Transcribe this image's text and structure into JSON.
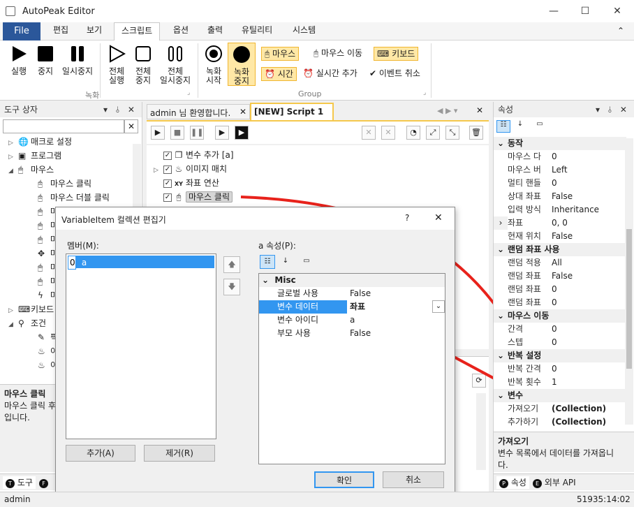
{
  "window": {
    "title": "AutoPeak Editor",
    "min": "—",
    "max": "☐",
    "close": "✕"
  },
  "menu": {
    "file": "File",
    "tabs": [
      "편집",
      "보기",
      "스크립트",
      "옵션",
      "출력",
      "유틸리티",
      "시스템"
    ],
    "collapse": "⌃"
  },
  "ribbon": {
    "record": {
      "run": "실행",
      "stop": "중지",
      "pause": "일시중지",
      "all_run": [
        "전체",
        "실행"
      ],
      "all_stop": [
        "전체",
        "중지"
      ],
      "all_pause": [
        "전체",
        "일시중지"
      ],
      "label": "녹화"
    },
    "group": {
      "rec_start": [
        "녹화",
        "시작"
      ],
      "rec_stop": [
        "녹화",
        "중지"
      ],
      "mouse": "마우스",
      "mouse_move": "마우스 이동",
      "keyboard": "키보드",
      "time": "시간",
      "realtime_add": "실시간 추가",
      "event_cancel": "이벤트 취소",
      "label": "Group"
    }
  },
  "toolbox": {
    "title": "도구 상자",
    "pin": "▾ ⫰ ✕",
    "clear": "✕",
    "items": [
      {
        "label": "매크로 설정",
        "icon": "globe-icon",
        "indent": 1,
        "exp": "▷"
      },
      {
        "label": "프로그램",
        "icon": "program-icon",
        "indent": 1,
        "exp": "▷"
      },
      {
        "label": "마우스",
        "icon": "mouse-icon",
        "indent": 1,
        "exp": "◢"
      },
      {
        "label": "마우스 클릭",
        "icon": "mouse-click-icon",
        "indent": 2,
        "exp": ""
      },
      {
        "label": "마우스 더블 클릭",
        "icon": "mouse-dblclick-icon",
        "indent": 2,
        "exp": ""
      },
      {
        "label": "마",
        "icon": "mouse-icon",
        "indent": 2,
        "exp": ""
      },
      {
        "label": "마",
        "icon": "mouse-icon",
        "indent": 2,
        "exp": ""
      },
      {
        "label": "마",
        "icon": "mouse-icon",
        "indent": 2,
        "exp": ""
      },
      {
        "label": "마",
        "icon": "move-icon",
        "indent": 2,
        "exp": ""
      },
      {
        "label": "마",
        "icon": "mouse-icon",
        "indent": 2,
        "exp": ""
      },
      {
        "label": "마",
        "icon": "mouse-icon",
        "indent": 2,
        "exp": ""
      },
      {
        "label": "마",
        "icon": "bolt-icon",
        "indent": 2,
        "exp": ""
      },
      {
        "label": "키보드",
        "icon": "keyboard-icon",
        "indent": 1,
        "exp": "▷"
      },
      {
        "label": "조건",
        "icon": "condition-icon",
        "indent": 1,
        "exp": "◢"
      },
      {
        "label": "픽",
        "icon": "eyedropper-icon",
        "indent": 2,
        "exp": ""
      },
      {
        "label": "이",
        "icon": "image-icon",
        "indent": 2,
        "exp": ""
      },
      {
        "label": "이",
        "icon": "image-icon",
        "indent": 2,
        "exp": ""
      }
    ],
    "desc_title": "마우스 클릭",
    "desc_text": [
      "마우스 클릭 후",
      "입니다."
    ],
    "bottom_tabs": [
      "도구",
      "F"
    ]
  },
  "editor": {
    "tabs": [
      {
        "label": "admin 님 환영합니다."
      },
      {
        "label": "[NEW] Script 1"
      }
    ],
    "rows": [
      {
        "text": "변수 추가 [a]",
        "icon": "variable-add-icon",
        "exp": ""
      },
      {
        "text": "이미지 매치",
        "icon": "image-match-icon",
        "exp": "▷"
      },
      {
        "text": "좌표 연산",
        "icon": "xy-icon",
        "exp": ""
      },
      {
        "text": "마우스 클릭",
        "icon": "mouse-click-icon",
        "exp": ""
      }
    ]
  },
  "properties": {
    "title": "속성",
    "pin": "▾ ⫰ ✕",
    "rows": [
      {
        "cat": "동작"
      },
      {
        "k": "마우스 다",
        "v": "0"
      },
      {
        "k": "마우스 버",
        "v": "Left"
      },
      {
        "k": "멀티 핸들",
        "v": "0"
      },
      {
        "k": "상대 좌표",
        "v": "False"
      },
      {
        "k": "입력 방식",
        "v": "Inheritance"
      },
      {
        "k": "좌표",
        "v": "0, 0",
        "exp": "›"
      },
      {
        "k": "현재 위치",
        "v": "False"
      },
      {
        "cat": "랜덤 좌표 사용"
      },
      {
        "k": "랜덤 적용",
        "v": "All"
      },
      {
        "k": "랜덤 좌표",
        "v": "False"
      },
      {
        "k": "랜덤 좌표",
        "v": "0"
      },
      {
        "k": "랜덤 좌표",
        "v": "0"
      },
      {
        "cat": "마우스 이동"
      },
      {
        "k": "간격",
        "v": "0"
      },
      {
        "k": "스텝",
        "v": "0"
      },
      {
        "cat": "반복 설정"
      },
      {
        "k": "반복 간격",
        "v": "0"
      },
      {
        "k": "반복 횟수",
        "v": "1"
      },
      {
        "cat": "변수"
      },
      {
        "k": "가져오기",
        "v": "(Collection)",
        "bold": true
      },
      {
        "k": "추가하기",
        "v": "(Collection)",
        "bold": true
      }
    ],
    "desc_title": "가져오기",
    "desc_text": [
      "변수 목록에서 데이터를 가져옵니",
      "다."
    ],
    "bottom_tabs": [
      "속성",
      "외부 API"
    ]
  },
  "dialog": {
    "title": "VariableItem 컬렉션 편집기",
    "help": "?",
    "close": "✕",
    "members_label": "멤버(M):",
    "members": [
      {
        "idx": "0",
        "name": "a"
      }
    ],
    "props_label": "a 속성(P):",
    "cat": "Misc",
    "props": [
      {
        "k": "글로벌 사용",
        "v": "False"
      },
      {
        "k": "변수 데이터",
        "v": "좌표",
        "selected": true
      },
      {
        "k": "변수 아이디",
        "v": "a"
      },
      {
        "k": "부모 사용",
        "v": "False"
      }
    ],
    "add": "추가(A)",
    "remove": "제거(R)",
    "ok": "확인",
    "cancel": "취소"
  },
  "status": {
    "user": "admin",
    "right": "51935:14:02"
  },
  "colors": {
    "accent": "#2b579a",
    "highlight": "#ffe8a6",
    "arrow": "#e8221b",
    "select": "#3296f0"
  }
}
